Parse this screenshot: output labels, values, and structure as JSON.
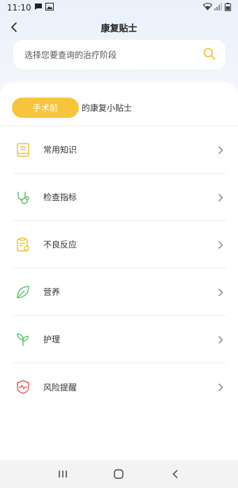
{
  "status_bar": {
    "time": "11:10"
  },
  "header": {
    "title": "康复贴士"
  },
  "search": {
    "placeholder": "选择您要查询的治疗阶段"
  },
  "stage": {
    "selected": "手术前",
    "suffix": "的康复小贴士"
  },
  "tips": [
    {
      "label": "常用知识",
      "icon": "book-icon"
    },
    {
      "label": "检查指标",
      "icon": "stethoscope-icon"
    },
    {
      "label": "不良反应",
      "icon": "clipboard-icon"
    },
    {
      "label": "营养",
      "icon": "leaf-icon"
    },
    {
      "label": "护理",
      "icon": "sprout-icon"
    },
    {
      "label": "风险提醒",
      "icon": "shield-alert-icon"
    }
  ],
  "colors": {
    "accent": "#F7C43D",
    "icon_yellow": "#F2BE32",
    "icon_green": "#5CC46A",
    "icon_red": "#E85A5A"
  }
}
